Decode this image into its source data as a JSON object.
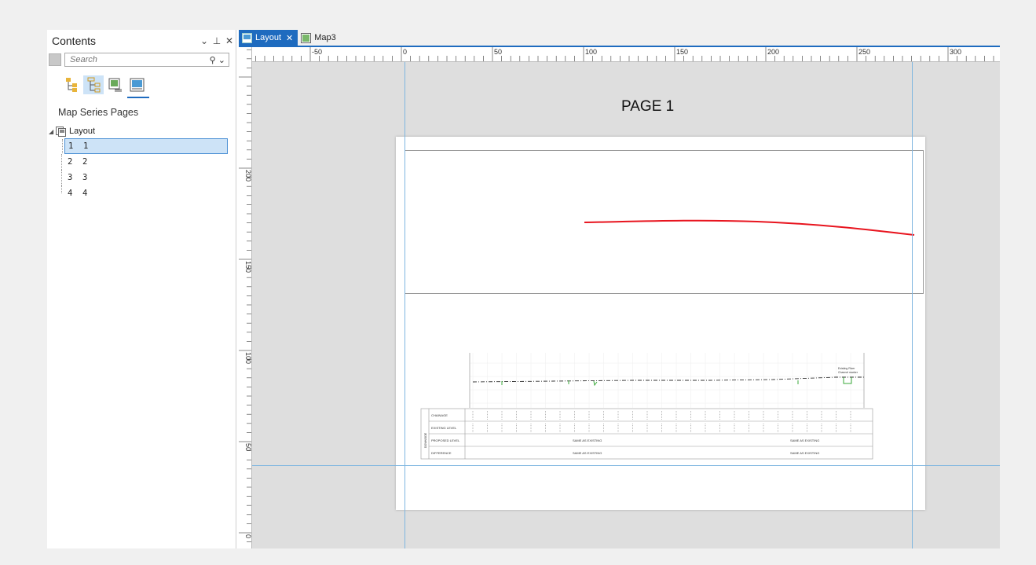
{
  "contents": {
    "title": "Contents",
    "controls": {
      "dropdown": "⌄",
      "pin": "ᵖ",
      "close": "✕"
    },
    "search_placeholder": "Search",
    "section_title": "Map Series Pages",
    "tree_root": "Layout",
    "pages": [
      {
        "label": "1  1",
        "selected": true
      },
      {
        "label": "2  2",
        "selected": false
      },
      {
        "label": "3  3",
        "selected": false
      },
      {
        "label": "4  4",
        "selected": false
      }
    ]
  },
  "tabs": [
    {
      "label": "Layout",
      "active": true
    },
    {
      "label": "Map3",
      "active": false
    }
  ],
  "ruler": {
    "horizontal_labels": [
      "-50",
      "0",
      "50",
      "100",
      "150",
      "200",
      "250",
      "300"
    ],
    "vertical_labels": [
      "200",
      "150",
      "100",
      "50",
      "0"
    ]
  },
  "page": {
    "title": "PAGE 1",
    "profile_table": {
      "side_label": "DOWNSIDE",
      "rows": [
        "CHAINAGE",
        "EXISTING LEVEL",
        "PROPOSED LEVEL",
        "DIFFERENCE"
      ],
      "proposed_left": "SAME AS EXISTING",
      "proposed_right": "SAME AS EXISTING",
      "difference_left": "SAME AS EXISTING",
      "difference_right": "SAME AS EXISTING",
      "annotation": [
        "Existing River",
        "Channel marker"
      ]
    }
  },
  "colors": {
    "accent": "#1e6bbf",
    "route_line": "#e8141e",
    "guides": "#7fb6e0"
  }
}
